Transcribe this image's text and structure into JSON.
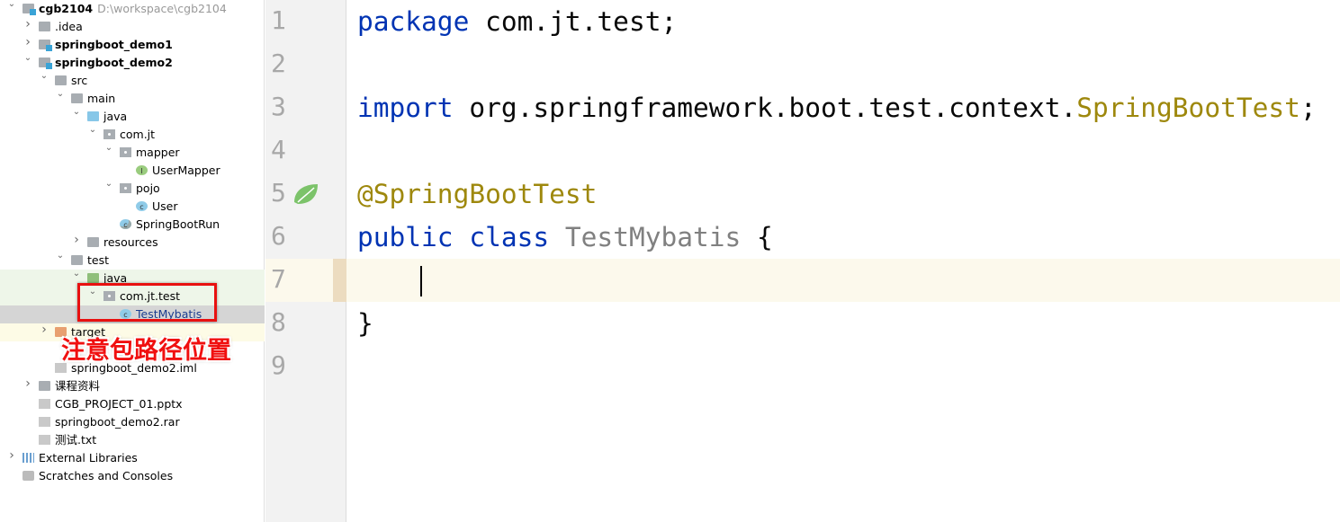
{
  "project_tree": [
    {
      "label": "cgb2104",
      "path": "D:\\workspace\\cgb2104",
      "level": 0,
      "chevron": "down",
      "icon": "module-folder-icon",
      "bold": true
    },
    {
      "label": ".idea",
      "level": 1,
      "chevron": "right",
      "icon": "folder-icon"
    },
    {
      "label": "springboot_demo1",
      "level": 1,
      "chevron": "right",
      "icon": "module-folder-icon",
      "bold": true
    },
    {
      "label": "springboot_demo2",
      "level": 1,
      "chevron": "down",
      "icon": "module-folder-icon",
      "bold": true
    },
    {
      "label": "src",
      "level": 2,
      "chevron": "down",
      "icon": "folder-icon"
    },
    {
      "label": "main",
      "level": 3,
      "chevron": "down",
      "icon": "folder-icon"
    },
    {
      "label": "java",
      "level": 4,
      "chevron": "down",
      "icon": "source-folder-icon"
    },
    {
      "label": "com.jt",
      "level": 5,
      "chevron": "down",
      "icon": "package-icon"
    },
    {
      "label": "mapper",
      "level": 6,
      "chevron": "down",
      "icon": "package-icon"
    },
    {
      "label": "UserMapper",
      "level": 7,
      "icon": "interface-icon"
    },
    {
      "label": "pojo",
      "level": 6,
      "chevron": "down",
      "icon": "package-icon"
    },
    {
      "label": "User",
      "level": 7,
      "icon": "class-icon"
    },
    {
      "label": "SpringBootRun",
      "level": 6,
      "icon": "spring-run-class-icon"
    },
    {
      "label": "resources",
      "level": 4,
      "chevron": "right",
      "icon": "resources-folder-icon"
    },
    {
      "label": "test",
      "level": 3,
      "chevron": "down",
      "icon": "folder-icon"
    },
    {
      "label": "java",
      "level": 4,
      "chevron": "down",
      "icon": "test-folder-icon"
    },
    {
      "label": "com.jt.test",
      "level": 5,
      "chevron": "down",
      "icon": "package-icon"
    },
    {
      "label": "TestMybatis",
      "level": 6,
      "icon": "class-icon",
      "selected": true
    },
    {
      "label": "target",
      "level": 2,
      "chevron": "right",
      "icon": "excluded-folder-icon"
    },
    {
      "label": "",
      "level": 2,
      "icon": "maven-icon"
    },
    {
      "label": "springboot_demo2.iml",
      "level": 2,
      "icon": "file-icon"
    },
    {
      "label": "课程资料",
      "level": 1,
      "chevron": "right",
      "icon": "folder-icon"
    },
    {
      "label": "CGB_PROJECT_01.pptx",
      "level": 1,
      "icon": "unknown-file-icon"
    },
    {
      "label": "springboot_demo2.rar",
      "level": 1,
      "icon": "unknown-file-icon"
    },
    {
      "label": "测试.txt",
      "level": 1,
      "icon": "text-file-icon"
    },
    {
      "label": "External Libraries",
      "level": 0,
      "chevron": "right",
      "icon": "libraries-icon"
    },
    {
      "label": "Scratches and Consoles",
      "level": 0,
      "icon": "scratches-icon"
    }
  ],
  "annotation": {
    "text": "注意包路径位置",
    "color": "#f01010"
  },
  "editor": {
    "current_line": 7,
    "lines": [
      {
        "n": "1",
        "tokens": [
          {
            "t": "package ",
            "c": "kw"
          },
          {
            "t": "com.jt.test;",
            "c": ""
          }
        ]
      },
      {
        "n": "2",
        "tokens": []
      },
      {
        "n": "3",
        "tokens": [
          {
            "t": "import ",
            "c": "kw"
          },
          {
            "t": "org.springframework.boot.test.context.",
            "c": ""
          },
          {
            "t": "SpringBootTest",
            "c": "an"
          },
          {
            "t": ";",
            "c": ""
          }
        ]
      },
      {
        "n": "4",
        "tokens": []
      },
      {
        "n": "5",
        "tokens": [
          {
            "t": "@SpringBootTest",
            "c": "an"
          }
        ],
        "gutter_icon": "spring-leaf-icon"
      },
      {
        "n": "6",
        "tokens": [
          {
            "t": "public ",
            "c": "kw"
          },
          {
            "t": "class ",
            "c": "kw"
          },
          {
            "t": "TestMybatis ",
            "c": "cn"
          },
          {
            "t": "{",
            "c": ""
          }
        ]
      },
      {
        "n": "7",
        "tokens": []
      },
      {
        "n": "8",
        "tokens": [
          {
            "t": "}",
            "c": ""
          }
        ]
      },
      {
        "n": "9",
        "tokens": []
      }
    ]
  },
  "colors": {
    "keyword": "#0033b3",
    "annotation": "#9e880d",
    "class_name": "#808080",
    "current_line": "#fcf9ec"
  }
}
